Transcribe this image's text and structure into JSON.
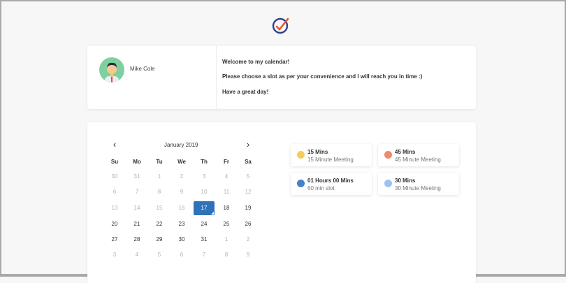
{
  "profile": {
    "name": "Mike Cole",
    "messages": [
      "Welcome to my calendar!",
      "Please choose a slot as per your convenience and I will reach you in time :)",
      "Have a great day!"
    ]
  },
  "calendar": {
    "month_label": "January 2019",
    "prev_icon": "‹",
    "next_icon": "›",
    "weekdays": [
      "Su",
      "Mo",
      "Tu",
      "We",
      "Th",
      "Fr",
      "Sa"
    ],
    "weeks": [
      [
        "30",
        "31",
        "1",
        "2",
        "3",
        "4",
        "5"
      ],
      [
        "6",
        "7",
        "8",
        "9",
        "10",
        "11",
        "12"
      ],
      [
        "13",
        "14",
        "15",
        "16",
        "17",
        "18",
        "19"
      ],
      [
        "20",
        "21",
        "22",
        "23",
        "24",
        "25",
        "26"
      ],
      [
        "27",
        "28",
        "29",
        "30",
        "31",
        "1",
        "2"
      ],
      [
        "3",
        "4",
        "5",
        "6",
        "7",
        "8",
        "9"
      ]
    ],
    "selected": "17"
  },
  "events": [
    {
      "title": "15 Mins",
      "subtitle": "15 Minute Meeting",
      "color": "#f5cd5a"
    },
    {
      "title": "45 Mins",
      "subtitle": "45 Minute Meeting",
      "color": "#f08a6a"
    },
    {
      "title": "01 Hours 00 Mins",
      "subtitle": "60 min slot",
      "color": "#4a7fcc"
    },
    {
      "title": "30 Mins",
      "subtitle": "30 Minute Meeting",
      "color": "#9cc3f0"
    }
  ]
}
